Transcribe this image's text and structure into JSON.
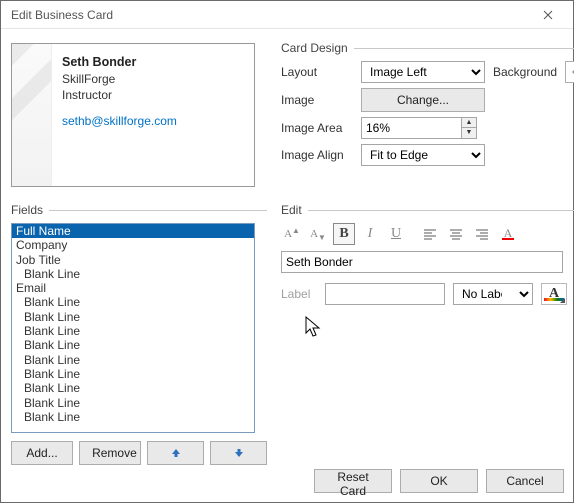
{
  "window": {
    "title": "Edit Business Card"
  },
  "preview": {
    "name": "Seth Bonder",
    "company": "SkillForge",
    "title": "Instructor",
    "email": "sethb@skillforge.com"
  },
  "card_design": {
    "section": "Card Design",
    "layout_lbl": "Layout",
    "layout_value": "Image Left",
    "background_lbl": "Background",
    "image_lbl": "Image",
    "change_btn": "Change...",
    "area_lbl": "Image Area",
    "area_value": "16%",
    "align_lbl": "Image Align",
    "align_value": "Fit to Edge"
  },
  "fields": {
    "section": "Fields",
    "items": [
      {
        "label": "Full Name",
        "indent": false,
        "selected": true
      },
      {
        "label": "Company",
        "indent": false,
        "selected": false
      },
      {
        "label": "Job Title",
        "indent": false,
        "selected": false
      },
      {
        "label": "Blank Line",
        "indent": true,
        "selected": false
      },
      {
        "label": "Email",
        "indent": false,
        "selected": false
      },
      {
        "label": "Blank Line",
        "indent": true,
        "selected": false
      },
      {
        "label": "Blank Line",
        "indent": true,
        "selected": false
      },
      {
        "label": "Blank Line",
        "indent": true,
        "selected": false
      },
      {
        "label": "Blank Line",
        "indent": true,
        "selected": false
      },
      {
        "label": "Blank Line",
        "indent": true,
        "selected": false
      },
      {
        "label": "Blank Line",
        "indent": true,
        "selected": false
      },
      {
        "label": "Blank Line",
        "indent": true,
        "selected": false
      },
      {
        "label": "Blank Line",
        "indent": true,
        "selected": false
      },
      {
        "label": "Blank Line",
        "indent": true,
        "selected": false
      }
    ],
    "add_btn": "Add...",
    "remove_btn": "Remove"
  },
  "edit": {
    "section": "Edit",
    "value": "Seth Bonder",
    "label_lbl": "Label",
    "label_value": "",
    "label_pos": "No Label"
  },
  "buttons": {
    "reset": "Reset Card",
    "ok": "OK",
    "cancel": "Cancel"
  }
}
